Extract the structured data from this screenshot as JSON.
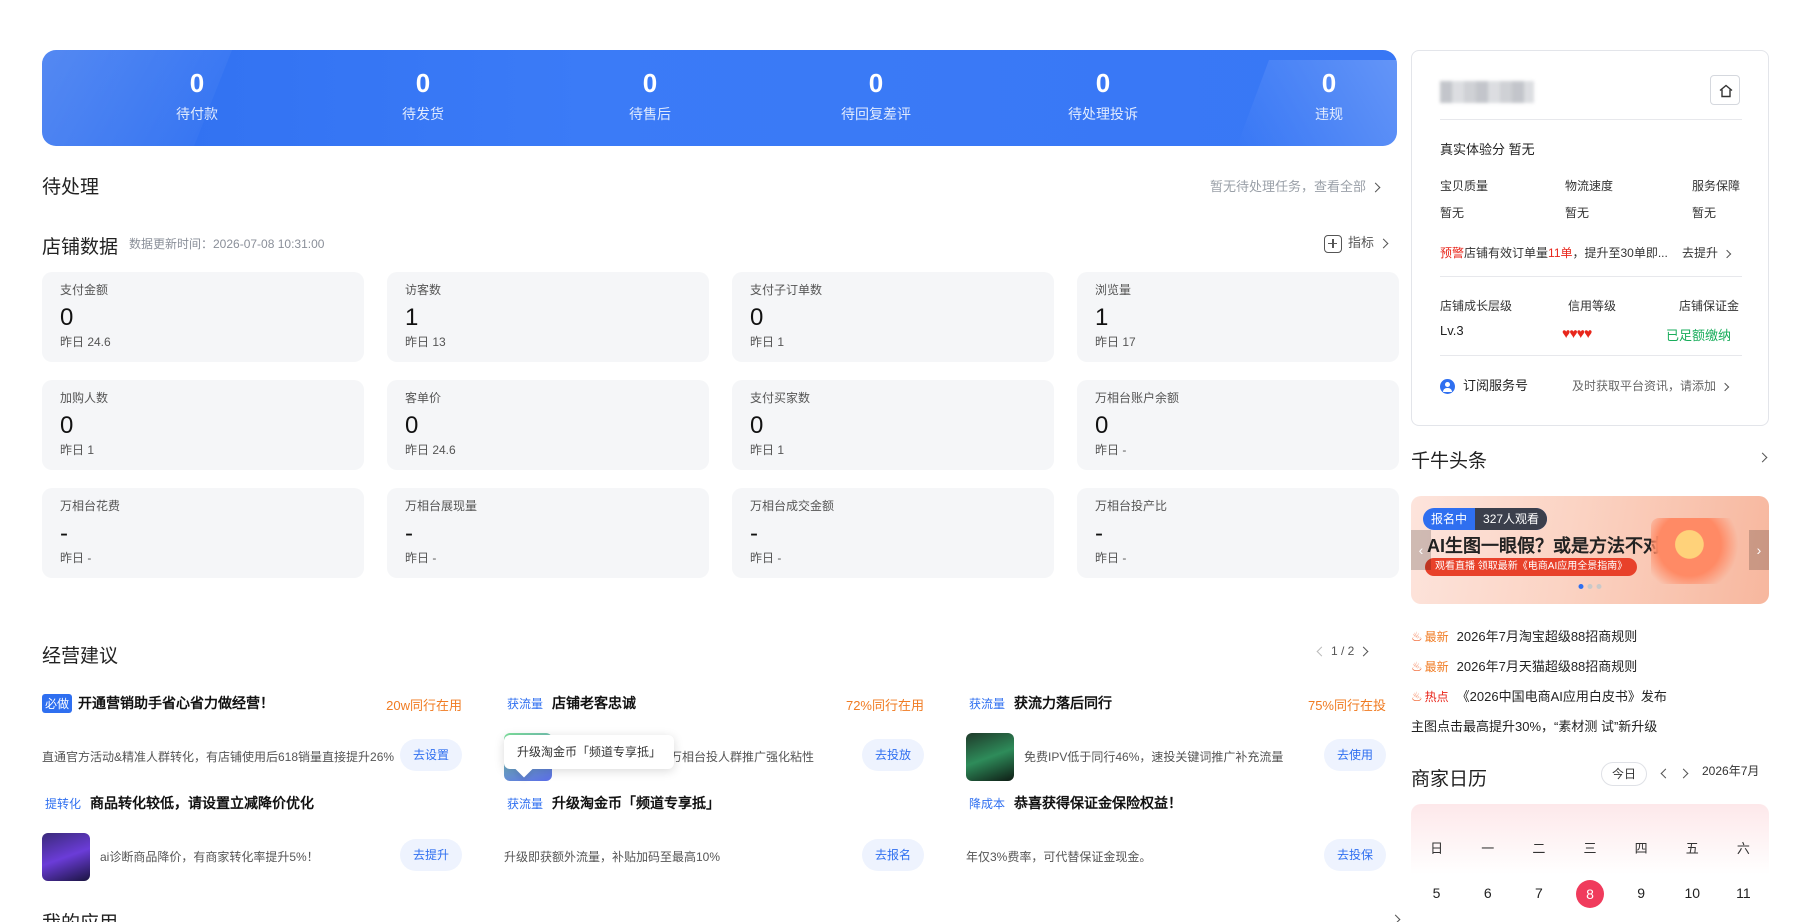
{
  "banner": {
    "stats": [
      {
        "value": "0",
        "label": "待付款"
      },
      {
        "value": "0",
        "label": "待发货"
      },
      {
        "value": "0",
        "label": "待售后"
      },
      {
        "value": "0",
        "label": "待回复差评"
      },
      {
        "value": "0",
        "label": "待处理投诉"
      },
      {
        "value": "0",
        "label": "违规"
      }
    ]
  },
  "pending": {
    "title": "待处理",
    "link": "暂无待处理任务，查看全部"
  },
  "store_data": {
    "title": "店铺数据",
    "update_time": "数据更新时间：2026-07-08 10:31:00",
    "metric_button": "指标",
    "cards": [
      {
        "label": "支付金额",
        "value": "0",
        "prev": "昨日 24.6"
      },
      {
        "label": "访客数",
        "value": "1",
        "prev": "昨日 13"
      },
      {
        "label": "支付子订单数",
        "value": "0",
        "prev": "昨日 1"
      },
      {
        "label": "浏览量",
        "value": "1",
        "prev": "昨日 17"
      },
      {
        "label": "加购人数",
        "value": "0",
        "prev": "昨日 1"
      },
      {
        "label": "客单价",
        "value": "0",
        "prev": "昨日 24.6"
      },
      {
        "label": "支付买家数",
        "value": "0",
        "prev": "昨日 1"
      },
      {
        "label": "万相台账户余额",
        "value": "0",
        "prev": "昨日 -"
      },
      {
        "label": "万相台花费",
        "value": "-",
        "prev": "昨日 -"
      },
      {
        "label": "万相台展现量",
        "value": "-",
        "prev": "昨日 -"
      },
      {
        "label": "万相台成交金额",
        "value": "-",
        "prev": "昨日 -"
      },
      {
        "label": "万相台投产比",
        "value": "-",
        "prev": "昨日 -"
      }
    ]
  },
  "suggestions": {
    "title": "经营建议",
    "pager": "1 / 2",
    "items": [
      {
        "tag": "必做",
        "title": "开通营销助手省心省力做经营！",
        "peer": "20w同行在用",
        "desc": "直通官方活动&精准人群转化，有店铺使用后618销量直接提升26%",
        "button": "去设置"
      },
      {
        "tag": "获流量",
        "title": "店铺老客忠诚",
        "peer": "72%同行在用",
        "desc": "对高价值老客，进行万相台投人群推广强化粘性",
        "button": "去投放"
      },
      {
        "tag": "获流量",
        "title": "获流力落后同行",
        "peer": "75%同行在投",
        "desc": "免费IPV低于同行46%，速投关键词推广补充流量",
        "button": "去使用"
      },
      {
        "tag": "提转化",
        "title": "商品转化较低，请设置立减降价优化",
        "peer": "",
        "desc": "ai诊断商品降价，有商家转化率提升5%！",
        "button": "去提升"
      },
      {
        "tag": "获流量",
        "title": "升级淘金币「频道专享抵」",
        "peer": "",
        "desc": "升级即获额外流量，补贴加码至最高10%",
        "button": "去报名"
      },
      {
        "tag": "降成本",
        "title": "恭喜获得保证金保险权益！",
        "peer": "",
        "desc": "年仅3%费率，可代替保证金现金。",
        "button": "去投保"
      }
    ],
    "tooltip": "升级淘金币「频道专享抵」"
  },
  "my_apps": {
    "title": "我的应用"
  },
  "shop_panel": {
    "experience_score": "真实体验分  暂无",
    "sub_scores": [
      {
        "label": "宝贝质量",
        "value": "暂无"
      },
      {
        "label": "物流速度",
        "value": "暂无"
      },
      {
        "label": "服务保障",
        "value": "暂无"
      }
    ],
    "warning": {
      "tag": "预警",
      "text_before": "店铺有效订单量",
      "count": "11单",
      "text_after": "，提升至30单即...",
      "action": "去提升"
    },
    "levels": [
      {
        "label": "店铺成长层级",
        "value": "Lv.3"
      },
      {
        "label": "信用等级",
        "value": "♥♥♥♥"
      },
      {
        "label": "店铺保证金",
        "value": "已足额缴纳"
      }
    ],
    "subscribe": {
      "label": "订阅服务号",
      "hint": "及时获取平台资讯，请添加"
    }
  },
  "qianniu": {
    "title": "千牛头条",
    "promo": {
      "badge": "报名中",
      "viewers": "327人观看",
      "title": "AI生图一眼假？或是方法不对",
      "subtitle": "观看直播  领取最新《电商AI应用全景指南》"
    },
    "news": [
      {
        "tag": "最新",
        "text": "2026年7月淘宝超级88招商规则"
      },
      {
        "tag": "最新",
        "text": "2026年7月天猫超级88招商规则"
      },
      {
        "tag": "热点",
        "text": "《2026中国电商AI应用白皮书》发布"
      },
      {
        "tag": "",
        "text": "主图点击最高提升30%，“素材测 试”新升级"
      }
    ]
  },
  "calendar": {
    "title": "商家日历",
    "today_label": "今日",
    "month": "2026年7月",
    "weekdays": [
      "日",
      "一",
      "二",
      "三",
      "四",
      "五",
      "六"
    ],
    "days": [
      "5",
      "6",
      "7",
      "8",
      "9",
      "10",
      "11"
    ],
    "today": "8"
  },
  "colors": {
    "primary": "#2f6ff0",
    "warn": "#e8261b",
    "orange": "#f07b22",
    "green": "#1aad5c",
    "today": "#f03b5c"
  }
}
